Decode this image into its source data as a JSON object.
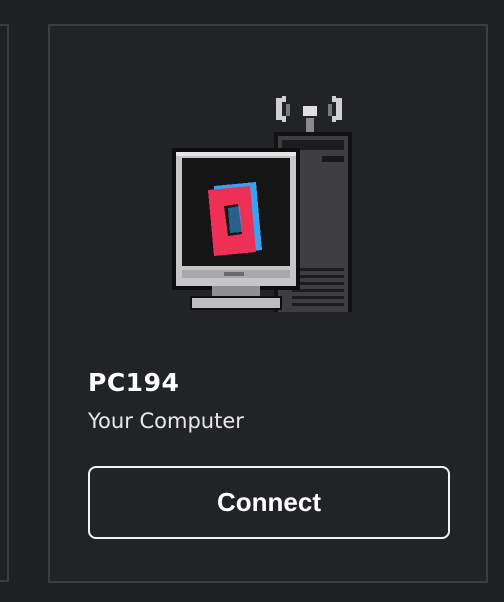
{
  "device": {
    "name": "PC194",
    "subtitle": "Your Computer",
    "icon": "computer-icon"
  },
  "actions": {
    "connect_label": "Connect"
  },
  "colors": {
    "background": "#1f2022",
    "card_border": "#3c3d40",
    "logo_red": "#ee2f56",
    "logo_blue": "#3aa0f0"
  }
}
